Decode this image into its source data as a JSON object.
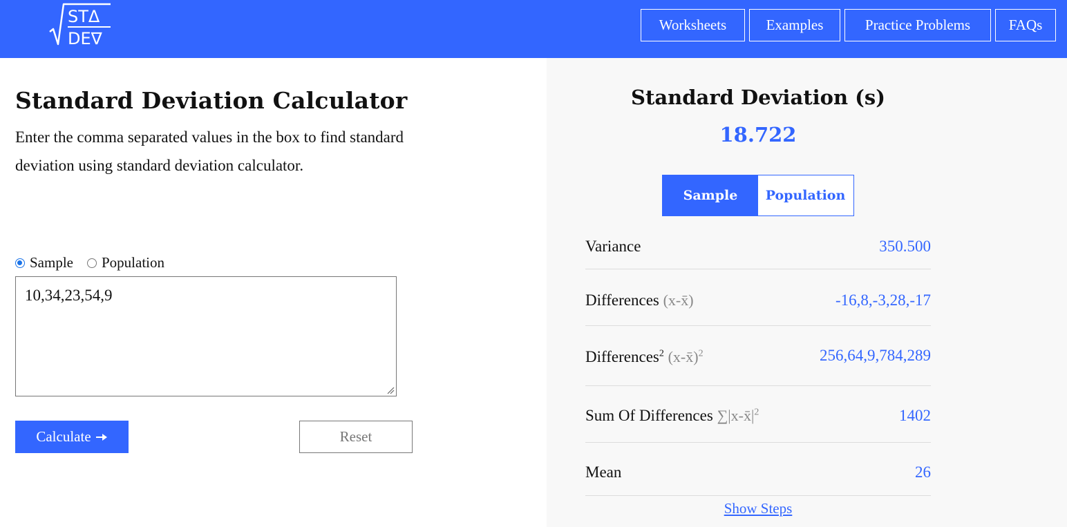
{
  "header": {
    "logo": {
      "top": "STΔ",
      "bottom": "DE∇"
    },
    "nav": [
      {
        "label": "Worksheets"
      },
      {
        "label": "Examples"
      },
      {
        "label": "Practice Problems"
      },
      {
        "label": "FAQs"
      }
    ]
  },
  "calculator": {
    "title": "Standard Deviation Calculator",
    "description": "Enter the comma separated values in the box to find standard deviation using standard deviation calculator.",
    "radios": [
      {
        "label": "Sample",
        "checked": true
      },
      {
        "label": "Population",
        "checked": false
      }
    ],
    "input_value": "10,34,23,54,9",
    "calculate_label": "Calculate",
    "calculate_icon": "arrow-right-icon",
    "reset_label": "Reset"
  },
  "result": {
    "title": "Standard Deviation (s)",
    "value": "18.722",
    "toggle": [
      {
        "label": "Sample",
        "active": true
      },
      {
        "label": "Population",
        "active": false
      }
    ],
    "rows": [
      {
        "label": "Variance",
        "formula": "",
        "value": "350.500"
      },
      {
        "label": "Differences",
        "formula": "(x-x̄)",
        "value": "-16,8,-3,28,-17"
      },
      {
        "label": "Differences",
        "label_sup": "2",
        "formula": "(x-x̄)",
        "formula_sup": "2",
        "value": "256,64,9,784,289"
      },
      {
        "label": "Sum Of Differences",
        "formula": "∑|x-x̄|",
        "formula_sup": "2",
        "value": "1402"
      },
      {
        "label": "Mean",
        "formula": "",
        "value": "26"
      }
    ],
    "show_steps_label": "Show Steps"
  },
  "colors": {
    "brand": "#3366ff",
    "panel_bg": "#f8f8f8",
    "text": "#111111",
    "formula_gray": "#888888"
  }
}
